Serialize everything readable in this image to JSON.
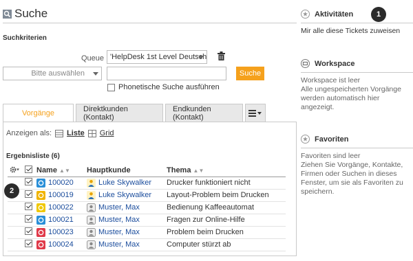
{
  "search": {
    "title": "Suche",
    "criteria_label": "Suchkriterien",
    "queue_label": "Queue",
    "queue_value": "'HelpDesk 1st Level Deutsch'",
    "choose_placeholder": "Bitte auswählen",
    "search_button": "Suche",
    "phonetic_label": "Phonetische Suche ausführen"
  },
  "tabs": [
    {
      "label": "Vorgänge",
      "active": true
    },
    {
      "label": "Direktkunden (Kontakt)",
      "active": false
    },
    {
      "label": "Endkunden (Kontakt)",
      "active": false
    }
  ],
  "view": {
    "label": "Anzeigen als:",
    "list": "Liste",
    "grid": "Grid"
  },
  "results": {
    "title": "Ergebnisliste (6)",
    "columns": [
      "Name",
      "Hauptkunde",
      "Thema"
    ],
    "rows": [
      {
        "id": "100020",
        "customer": "Luke Skywalker",
        "topic": "Drucker funktioniert nicht",
        "icon_color": "#2a8fd8",
        "person": "user"
      },
      {
        "id": "100019",
        "customer": "Luke Skywalker",
        "topic": "Layout-Problem beim Drucken",
        "icon_color": "#f0b400",
        "person": "user"
      },
      {
        "id": "100022",
        "customer": "Muster, Max",
        "topic": "Bedienung Kaffeeautomat",
        "icon_color": "#f0c800",
        "person": "contact"
      },
      {
        "id": "100021",
        "customer": "Muster, Max",
        "topic": "Fragen zur Online-Hilfe",
        "icon_color": "#2a8fd8",
        "person": "contact"
      },
      {
        "id": "100023",
        "customer": "Muster, Max",
        "topic": "Problem beim Drucken",
        "icon_color": "#e03a4a",
        "person": "contact"
      },
      {
        "id": "100024",
        "customer": "Muster, Max",
        "topic": "Computer stürzt ab",
        "icon_color": "#e03a4a",
        "person": "contact"
      }
    ]
  },
  "badges": {
    "one": "1",
    "two": "2"
  },
  "sidebar": {
    "activities": {
      "title": "Aktivitäten",
      "text": "Mir alle diese Tickets zuweisen"
    },
    "workspace": {
      "title": "Workspace",
      "text": "Workspace ist leer\nAlle ungespeicherten Vorgänge werden automatisch hier angezeigt."
    },
    "favorites": {
      "title": "Favoriten",
      "text": "Favoriten sind leer\nZiehen Sie Vorgänge, Kontakte, Firmen oder Suchen in dieses Fenster, um sie als Favoriten zu speichern."
    }
  }
}
